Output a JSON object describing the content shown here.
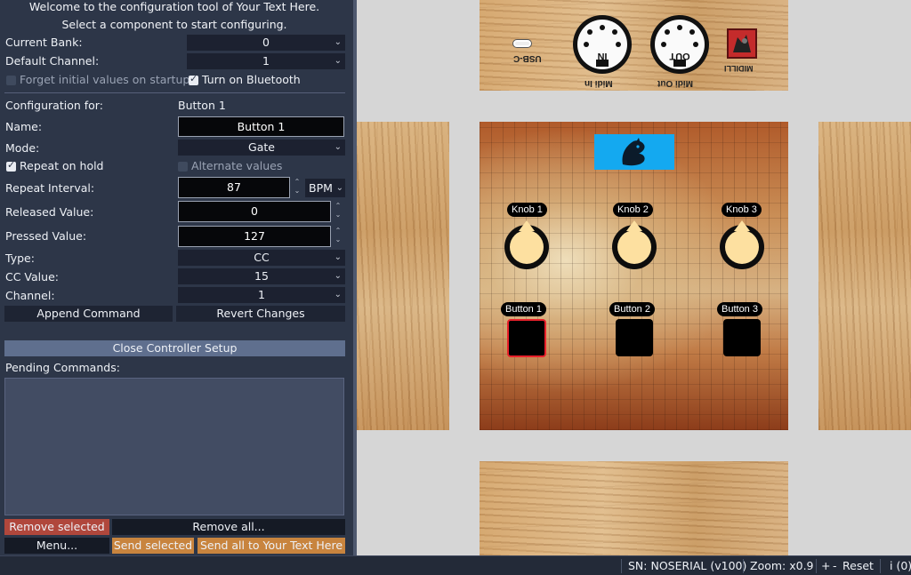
{
  "header": {
    "line1": "Welcome to the configuration tool of Your Text Here.",
    "line2": "Select a component to start configuring."
  },
  "globals": {
    "bank_label": "Current Bank:",
    "bank_value": "0",
    "channel_label": "Default Channel:",
    "channel_value": "1",
    "forget_label": "Forget initial values on startup",
    "forget_checked": false,
    "bluetooth_label": "Turn on Bluetooth",
    "bluetooth_checked": true
  },
  "config": {
    "for_label": "Configuration for:",
    "for_value": "Button 1",
    "name_label": "Name:",
    "name_value": "Button 1",
    "mode_label": "Mode:",
    "mode_value": "Gate",
    "repeat_label": "Repeat on hold",
    "repeat_checked": true,
    "alternate_label": "Alternate values",
    "alternate_checked": false,
    "interval_label": "Repeat Interval:",
    "interval_value": "87",
    "interval_unit": "BPM",
    "released_label": "Released Value:",
    "released_value": "0",
    "pressed_label": "Pressed Value:",
    "pressed_value": "127",
    "type_label": "Type:",
    "type_value": "CC",
    "cc_label": "CC Value:",
    "cc_value": "15",
    "chan_label": "Channel:",
    "chan_value": "1",
    "append_label": "Append Command",
    "revert_label": "Revert Changes"
  },
  "close_label": "Close Controller Setup",
  "pending": {
    "label": "Pending Commands:",
    "items": []
  },
  "actions": {
    "remove_selected": "Remove selected",
    "remove_all": "Remove all...",
    "menu": "Menu...",
    "send_selected": "Send selected",
    "send_all": "Send all to Your Text Here"
  },
  "status": {
    "serial": "SN: NOSERIAL (v100)",
    "zoom": "Zoom: x0.9",
    "plus": "+",
    "minus": "-",
    "reset": "Reset",
    "info": "i (0)"
  },
  "device": {
    "top_panel": {
      "usb": "USB-C",
      "midi_in_jack": "IN",
      "midi_in_label": "Midi In",
      "midi_out_jack": "OUT",
      "midi_out_label": "Midi Out",
      "brand": "MIDILLI"
    },
    "knobs": [
      "Knob 1",
      "Knob 2",
      "Knob 3"
    ],
    "buttons": [
      "Button 1",
      "Button 2",
      "Button 3"
    ],
    "selected_button": "Button 1"
  },
  "colors": {
    "panel_bg": "#2d3648",
    "accent_orange": "#c8843e",
    "danger_red": "#b0473c",
    "selection_red": "#e8202a",
    "logo_blue": "#14a9f0",
    "knob_cream": "#fde0a0"
  }
}
